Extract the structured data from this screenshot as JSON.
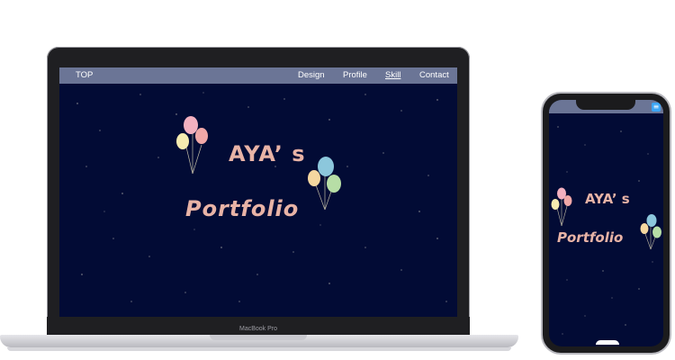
{
  "laptop": {
    "brand_label": "MacBook Pro",
    "nav": {
      "top": "TOP",
      "design": "Design",
      "profile": "Profile",
      "skill": "Skill",
      "contact": "Contact"
    },
    "hero": {
      "line1": "AYA’ s",
      "line2": "Portfolio"
    }
  },
  "phone": {
    "menu_icon": "hamburger-menu-icon",
    "hero": {
      "line1": "AYA’ s",
      "line2": "Portfolio"
    }
  },
  "colors": {
    "background": "#020b35",
    "nav_bar": "#6b7596",
    "hero_text": "#e8b3a6",
    "menu_button": "#3da5f4"
  }
}
